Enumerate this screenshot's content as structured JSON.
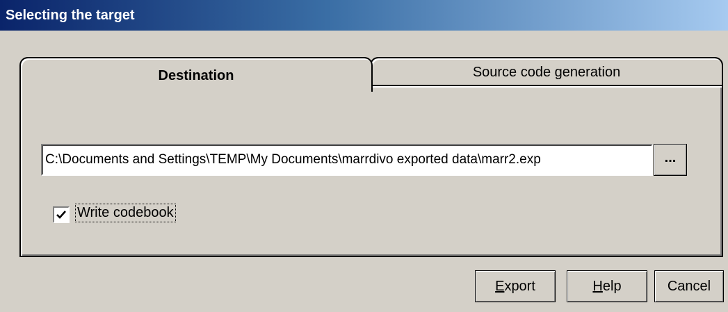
{
  "window": {
    "title": "Selecting the target"
  },
  "tabs": [
    {
      "label": "Destination"
    },
    {
      "label": "Source code generation"
    }
  ],
  "destination": {
    "path_value": "C:\\Documents and Settings\\TEMP\\My Documents\\marrdivo exported data\\marr2.exp",
    "browse_label": "...",
    "write_codebook_label": "Write codebook",
    "write_codebook_checked": true
  },
  "buttons": {
    "export": {
      "mnemonic": "E",
      "rest": "xport"
    },
    "help": {
      "mnemonic": "H",
      "rest": "elp"
    },
    "cancel": "Cancel"
  }
}
